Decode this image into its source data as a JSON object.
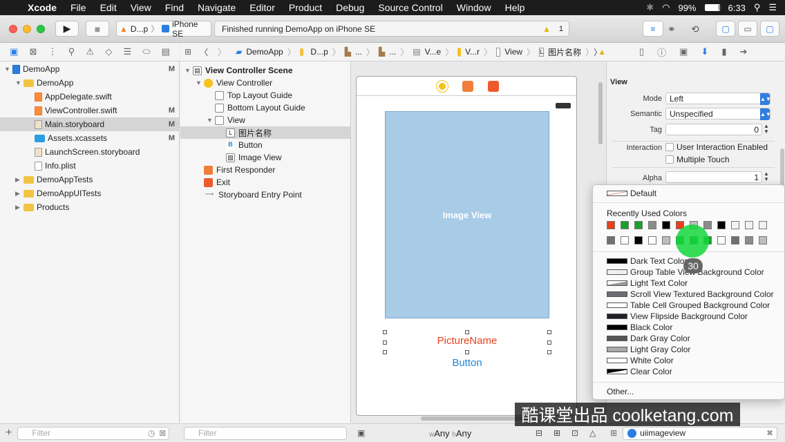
{
  "menubar": {
    "app": "Xcode",
    "items": [
      "File",
      "Edit",
      "View",
      "Find",
      "Navigate",
      "Editor",
      "Product",
      "Debug",
      "Source Control",
      "Window",
      "Help"
    ],
    "battery": "99%",
    "time": "6:33"
  },
  "toolbar": {
    "scheme": "D...p",
    "device": "iPhone SE",
    "activity": "Finished running DemoApp on iPhone SE",
    "warnings": "1"
  },
  "jumpbar": {
    "items": [
      "DemoApp",
      "D...p",
      "...",
      "...",
      "V...e",
      "V...r",
      "View",
      "图片名称"
    ]
  },
  "navigator": {
    "rows": [
      {
        "label": "DemoApp",
        "level": 0,
        "type": "project",
        "status": "M"
      },
      {
        "label": "DemoApp",
        "level": 1,
        "type": "folder",
        "status": ""
      },
      {
        "label": "AppDelegate.swift",
        "level": 2,
        "type": "swift",
        "status": ""
      },
      {
        "label": "ViewController.swift",
        "level": 2,
        "type": "swift",
        "status": "M"
      },
      {
        "label": "Main.storyboard",
        "level": 2,
        "type": "storyboard",
        "status": "M"
      },
      {
        "label": "Assets.xcassets",
        "level": 2,
        "type": "assets",
        "status": "M"
      },
      {
        "label": "LaunchScreen.storyboard",
        "level": 2,
        "type": "storyboard",
        "status": ""
      },
      {
        "label": "Info.plist",
        "level": 2,
        "type": "plist",
        "status": ""
      },
      {
        "label": "DemoAppTests",
        "level": 1,
        "type": "folder",
        "status": ""
      },
      {
        "label": "DemoAppUITests",
        "level": 1,
        "type": "folder",
        "status": ""
      },
      {
        "label": "Products",
        "level": 1,
        "type": "folder",
        "status": ""
      }
    ],
    "filter_placeholder": "Filter"
  },
  "outline": {
    "rows": [
      {
        "label": "View Controller Scene",
        "level": 0,
        "icon": "scene"
      },
      {
        "label": "View Controller",
        "level": 1,
        "icon": "vc"
      },
      {
        "label": "Top Layout Guide",
        "level": 2,
        "icon": "guide"
      },
      {
        "label": "Bottom Layout Guide",
        "level": 2,
        "icon": "guide"
      },
      {
        "label": "View",
        "level": 2,
        "icon": "view"
      },
      {
        "label": "图片名称",
        "level": 3,
        "icon": "L"
      },
      {
        "label": "Button",
        "level": 3,
        "icon": "B"
      },
      {
        "label": "Image View",
        "level": 3,
        "icon": "img"
      },
      {
        "label": "First Responder",
        "level": 1,
        "icon": "responder"
      },
      {
        "label": "Exit",
        "level": 1,
        "icon": "exit"
      },
      {
        "label": "Storyboard Entry Point",
        "level": 1,
        "icon": "arrow"
      }
    ],
    "filter_placeholder": "Filter"
  },
  "canvas": {
    "imageview_label": "Image View",
    "picture_label": "PictureName",
    "button_label": "Button",
    "size_w": "Any",
    "size_h": "Any",
    "w_prefix": "w",
    "h_prefix": "h"
  },
  "inspector": {
    "section": "View",
    "mode_label": "Mode",
    "mode_value": "Left",
    "semantic_label": "Semantic",
    "semantic_value": "Unspecified",
    "tag_label": "Tag",
    "tag_value": "0",
    "interaction_label": "Interaction",
    "user_interaction": "User Interaction Enabled",
    "multiple_touch": "Multiple Touch",
    "alpha_label": "Alpha",
    "alpha_value": "1",
    "search_value": "uiimageview"
  },
  "colorpopover": {
    "default": "Default",
    "recent_title": "Recently Used Colors",
    "recent_row1": [
      "#e8401c",
      "#18a22a",
      "#18a22a",
      "#8c8c8c",
      "#000000",
      "#e8401c",
      "#bdbdbd",
      "#8c8c8c",
      "#000000",
      "#f2f2f2",
      "#f2f2f2",
      "#f2f2f2"
    ],
    "recent_row2": [
      "#707070",
      "#ffffff",
      "#000000",
      "#ffffff",
      "#bdbdbd",
      "#18a22a",
      "#18a22a",
      "#18a22a",
      "#ffffff",
      "#707070",
      "#8c8c8c",
      "#bdbdbd"
    ],
    "named": [
      {
        "label": "Dark Text Color",
        "color": "#000000"
      },
      {
        "label": "Group Table View Background Color",
        "color": "#efeff4"
      },
      {
        "label": "Light Text Color",
        "color": "#cccccc"
      },
      {
        "label": "Scroll View Textured Background Color",
        "color": "#6d6d72"
      },
      {
        "label": "Table Cell Grouped Background Color",
        "color": "#ffffff"
      },
      {
        "label": "View Flipside Background Color",
        "color": "#1f2124"
      },
      {
        "label": "Black Color",
        "color": "#000000"
      },
      {
        "label": "Dark Gray Color",
        "color": "#555555"
      },
      {
        "label": "Light Gray Color",
        "color": "#aaaaaa"
      },
      {
        "label": "White Color",
        "color": "#ffffff"
      },
      {
        "label": "Clear Color",
        "color": "#ffffff"
      }
    ],
    "other": "Other..."
  },
  "cursor": {
    "click_count": "30"
  },
  "watermark": "酷课堂出品 coolketang.com"
}
